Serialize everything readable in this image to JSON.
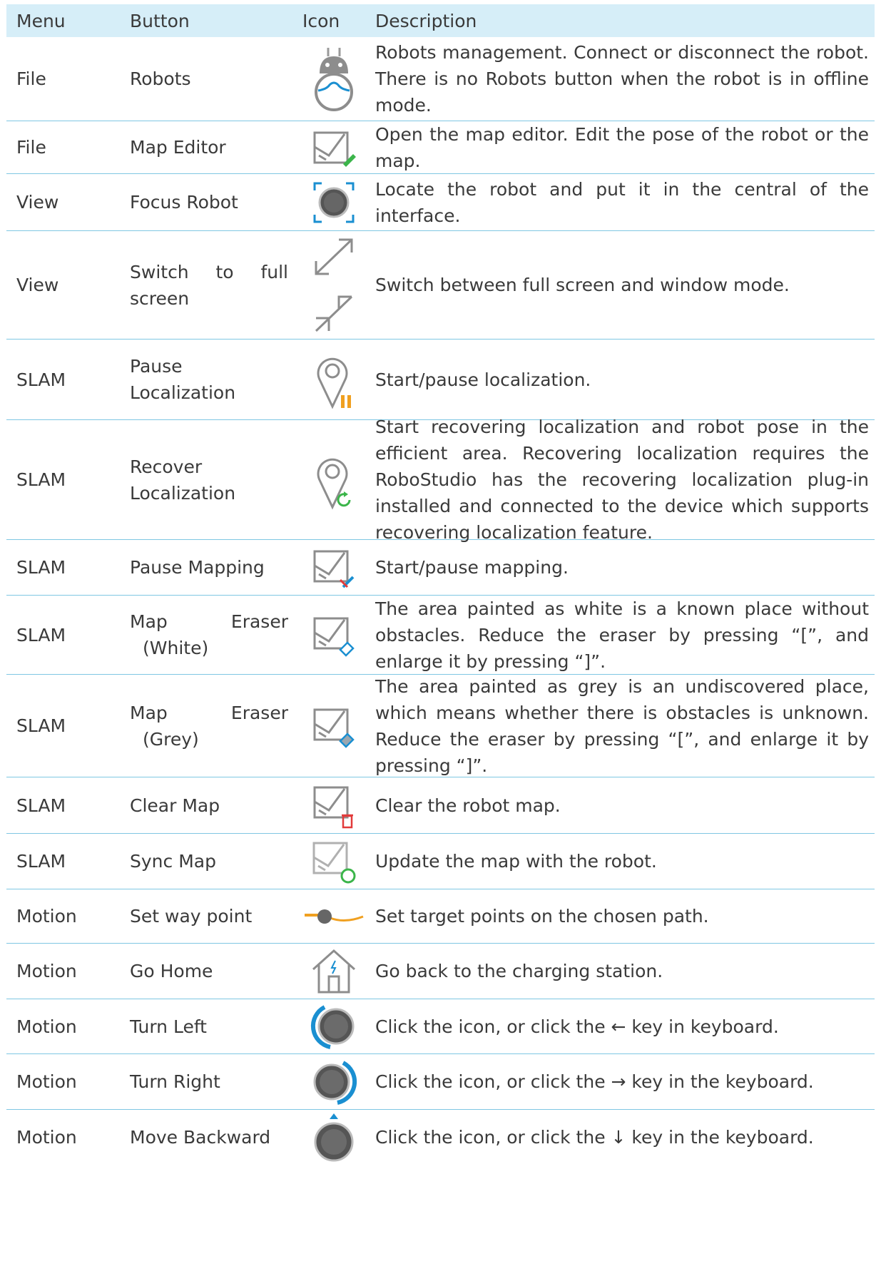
{
  "header": {
    "menu": "Menu",
    "button": "Button",
    "icon": "Icon",
    "description": "Description"
  },
  "rows": [
    {
      "menu": "File",
      "button": "Robots",
      "icon": "robot-icon",
      "description": "Robots management. Connect or disconnect the robot. There is no Robots button when the robot is in offline mode."
    },
    {
      "menu": "File",
      "button": "Map Editor",
      "icon": "map-editor-icon",
      "description": "Open the map editor. Edit the pose of the robot or the map."
    },
    {
      "menu": "View",
      "button": "Focus Robot",
      "icon": "focus-robot-icon",
      "description": "Locate the robot and put it in the central of the interface."
    },
    {
      "menu": "View",
      "button": "Switch to full screen",
      "button_l1": "Switch to full",
      "button_l2": "screen",
      "icon": "fullscreen-icon",
      "description": "Switch between full screen and window mode."
    },
    {
      "menu": "SLAM",
      "button": "Pause Localization",
      "button_l1": "Pause",
      "button_l2": "Localization",
      "icon": "pause-localization-icon",
      "description": "Start/pause localization."
    },
    {
      "menu": "SLAM",
      "button": "Recover Localization",
      "button_l1": "Recover",
      "button_l2": "Localization",
      "icon": "recover-localization-icon",
      "description": "Start recovering localization and robot pose in the efficient area. Recovering localization requires the RoboStudio has the recovering localization plug-in installed and connected to the device which supports recovering localization feature."
    },
    {
      "menu": "SLAM",
      "button": "Pause Mapping",
      "icon": "pause-mapping-icon",
      "description": "Start/pause mapping."
    },
    {
      "menu": "SLAM",
      "button": "Map Eraser (White)",
      "button_l1": "Map Eraser",
      "button_l2": "(White)",
      "icon": "eraser-white-icon",
      "description": "The area painted as white is a known place without obstacles. Reduce the eraser by pressing “[”, and enlarge it by pressing “]”."
    },
    {
      "menu": "SLAM",
      "button": "Map Eraser (Grey)",
      "button_l1": "Map Eraser",
      "button_l2": "(Grey)",
      "icon": "eraser-grey-icon",
      "description": "The area painted as grey is an undiscovered place, which means whether there is obstacles is unknown. Reduce the eraser by pressing “[”, and enlarge it by pressing “]”."
    },
    {
      "menu": "SLAM",
      "button": "Clear Map",
      "icon": "clear-map-icon",
      "description": "Clear the robot map."
    },
    {
      "menu": "SLAM",
      "button": "Sync Map",
      "icon": "sync-map-icon",
      "description": "Update the map with the robot."
    },
    {
      "menu": "Motion",
      "button": "Set way point",
      "icon": "way-point-icon",
      "description": "Set target points on the chosen path."
    },
    {
      "menu": "Motion",
      "button": "Go Home",
      "icon": "home-icon",
      "description": "Go back to the charging station."
    },
    {
      "menu": "Motion",
      "button": "Turn Left",
      "icon": "turn-left-icon",
      "description": "Click the icon, or click the ← key in keyboard."
    },
    {
      "menu": "Motion",
      "button": "Turn Right",
      "icon": "turn-right-icon",
      "description": "Click the icon, or click the → key in the keyboard."
    },
    {
      "menu": "Motion",
      "button": "Move Backward",
      "icon": "move-backward-icon",
      "description": "Click the icon, or click the ↓ key in the keyboard."
    }
  ],
  "colors": {
    "header_bg": "#d6eef8",
    "row_border": "#7fc7e3",
    "accent_blue": "#1a8fd1",
    "accent_orange": "#f0a020",
    "accent_green": "#3bb54a",
    "accent_red": "#e23b3b"
  }
}
